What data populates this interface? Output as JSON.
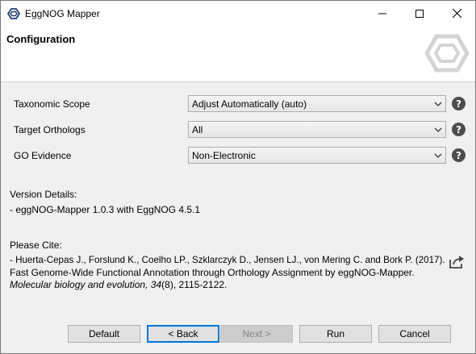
{
  "window": {
    "title": "EggNOG Mapper",
    "controls": {
      "minimize_icon": "minimize-icon",
      "maximize_icon": "maximize-icon",
      "close_icon": "close-icon"
    }
  },
  "header": {
    "title": "Configuration",
    "logo_icon": "hexagon-logo-icon"
  },
  "form": {
    "rows": [
      {
        "label": "Taxonomic Scope",
        "value": "Adjust Automatically (auto)"
      },
      {
        "label": "Target Orthologs",
        "value": "All"
      },
      {
        "label": "GO Evidence",
        "value": "Non-Electronic"
      }
    ],
    "help_icon": "?"
  },
  "version": {
    "heading": "Version Details:",
    "detail": "- eggNOG-Mapper 1.0.3 with EggNOG 4.5.1"
  },
  "citation": {
    "heading": "Please Cite:",
    "line1": "- Huerta-Cepas J., Forslund K., Coelho LP., Szklarczyk D., Jensen LJ., von Mering C. and Bork P. (2017).",
    "line2": "Fast Genome-Wide Functional Annotation through Orthology Assignment by eggNOG-Mapper.",
    "line3_journal": "Molecular biology and evolution,",
    "line3_volume": "34",
    "line3_rest": "(8), 2115-2122.",
    "share_icon": "share-export-icon"
  },
  "buttons": {
    "default": "Default",
    "back": "< Back",
    "next": "Next >",
    "run": "Run",
    "cancel": "Cancel"
  },
  "colors": {
    "accent": "#0078d7",
    "logo": "#d4d4d4",
    "help_icon_bg": "#4d4d4d"
  }
}
